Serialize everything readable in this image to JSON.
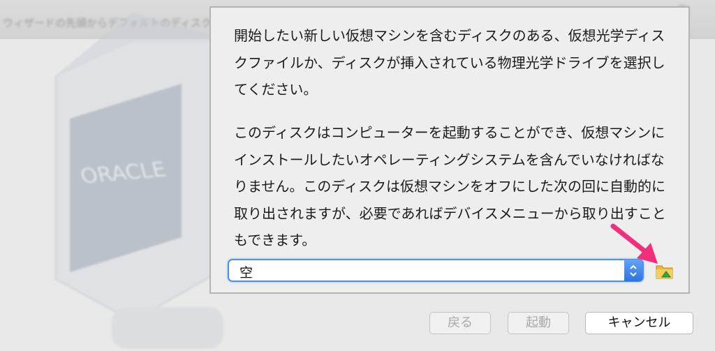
{
  "background": {
    "window_title_blurred": "ウィザードの先頭からデフォルトのディスクでの仮想マシンを起動するように、起動するディスクを選択します。"
  },
  "dialog": {
    "paragraph1": "開始したい新しい仮想マシンを含むディスクのある、仮想光学ディスクファイルか、ディスクが挿入されている物理光学ドライブを選択してください。",
    "paragraph2": "このディスクはコンピューターを起動することができ、仮想マシンにインストールしたいオペレーティングシステムを含んでいなければなりません。このディスクは仮想マシンをオフにした次の回に自動的に取り出されますが、必要であればデバイスメニューから取り出すこともできます。",
    "disk_select": {
      "value": "空"
    },
    "folder_icon": "folder-open-icon",
    "annotation_arrow_color": "#f0307a"
  },
  "buttons": {
    "back": "戻る",
    "start": "起動",
    "cancel": "キャンセル"
  },
  "colors": {
    "accent": "#4f8fe6",
    "stepper": "#2f73e0"
  }
}
